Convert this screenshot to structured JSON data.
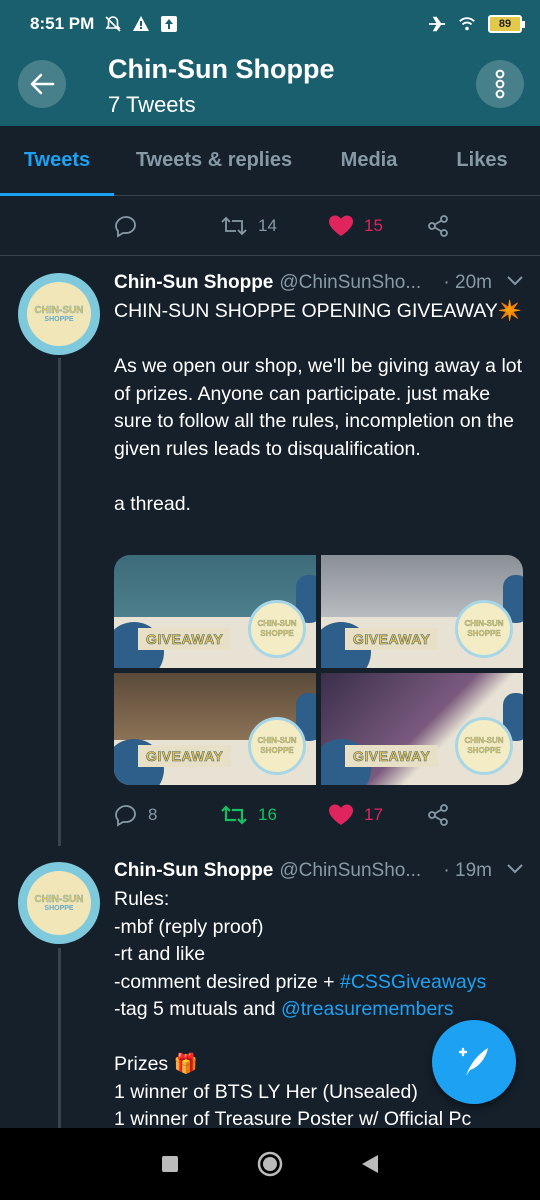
{
  "status_bar": {
    "time": "8:51 PM",
    "battery": "89",
    "left_icons": [
      "silent-bell-icon",
      "warning-icon",
      "upload-icon"
    ],
    "right_icons": [
      "airplane-icon",
      "wifi-icon",
      "battery-icon"
    ]
  },
  "header": {
    "title": "Chin-Sun Shoppe",
    "subtitle": "7 Tweets"
  },
  "tabs": [
    {
      "label": "Tweets",
      "active": true
    },
    {
      "label": "Tweets & replies",
      "active": false
    },
    {
      "label": "Media",
      "active": false
    },
    {
      "label": "Likes",
      "active": false
    }
  ],
  "top_actions": {
    "retweets": "14",
    "likes": "15"
  },
  "tweet1": {
    "name": "Chin-Sun Shoppe",
    "handle": "@ChinSunSho...",
    "time": "· 20m",
    "text": "CHIN-SUN SHOPPE OPENING GIVEAWAY✴️\n\nAs we open our shop, we'll be giving away a lot of prizes. Anyone can participate. just make sure to follow all the rules, incompletion on the given rules leads to disqualification.\n\na thread.",
    "media": [
      {
        "caption": "GIVEAWAY",
        "badge_line1": "CHIN-SUN",
        "badge_line2": "SHOPPE"
      },
      {
        "caption": "GIVEAWAY",
        "badge_line1": "CHIN-SUN",
        "badge_line2": "SHOPPE"
      },
      {
        "caption": "GIVEAWAY",
        "badge_line1": "CHIN-SUN",
        "badge_line2": "SHOPPE"
      },
      {
        "caption": "GIVEAWAY",
        "badge_line1": "CHIN-SUN",
        "badge_line2": "SHOPPE"
      }
    ],
    "replies": "8",
    "retweets": "16",
    "likes": "17"
  },
  "tweet2": {
    "name": "Chin-Sun Shoppe",
    "handle": "@ChinSunSho...",
    "time": "· 19m",
    "line1": "Rules:",
    "line2": "-mbf (reply proof)",
    "line3": "-rt and like",
    "line4_prefix": "-comment desired prize + ",
    "line4_link": "#CSSGiveaways",
    "line5_prefix": "-tag 5 mutuals and ",
    "line5_link": "@treasuremembers",
    "line6": "Prizes 🎁",
    "line7": "1 winner of BTS LY Her (Unsealed)",
    "line8": "1 winner of Treasure Poster w/ Official Pc"
  },
  "avatar": {
    "line1": "CHIN-SUN",
    "line2": "SHOPPE"
  },
  "colors": {
    "header_bg": "#1a5f6e",
    "page_bg": "#15202b",
    "accent": "#1da1f2",
    "like": "#e0245e",
    "retweet_active": "#17bf63",
    "muted": "#8899a6"
  }
}
